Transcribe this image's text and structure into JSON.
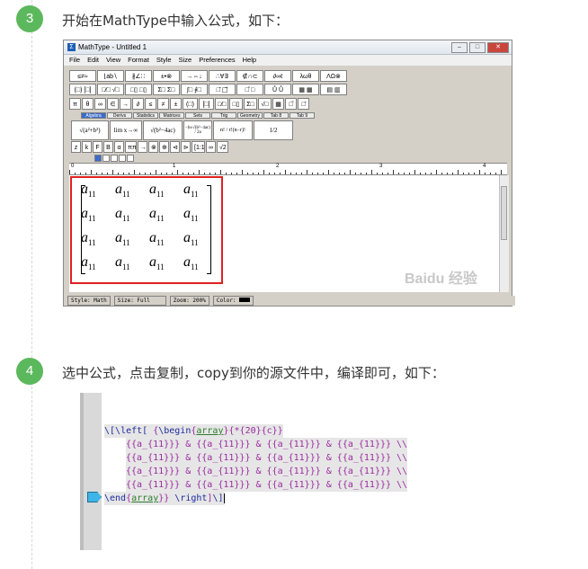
{
  "steps": [
    {
      "number": "3",
      "text": "开始在MathType中输入公式，如下："
    },
    {
      "number": "4",
      "text": "选中公式，点击复制，copy到你的源文件中，编译即可，如下："
    }
  ],
  "mathtype": {
    "title": "MathType - Untitled 1",
    "window_buttons": [
      "–",
      "□",
      "✕"
    ],
    "menu": [
      "File",
      "Edit",
      "View",
      "Format",
      "Style",
      "Size",
      "Preferences",
      "Help"
    ],
    "toolbar_row1": [
      "≤≠≈",
      "⌊ab∖",
      "∦∠∷",
      "±•⊗",
      "→⇔↓",
      "∴∀∃",
      "∉∩⊂",
      "∂∞ℓ",
      "λωθ",
      "ΛΩ⊗"
    ],
    "toolbar_row2": [
      "(□) [□]",
      "□⁄□ √□",
      "□▯ □▯",
      "Σ□ Σ□",
      "∫□ ∮□",
      "□̄ □⃗",
      "□̂ □",
      "Ů Ů",
      "▦ ▦",
      "▤ ▥"
    ],
    "toolbar_row3": [
      "π",
      "θ",
      "∞",
      "∈",
      "→",
      "∂",
      "≤",
      "≠",
      "±",
      "(□)",
      "[□]",
      "□⁄□",
      "□▯",
      "Σ□",
      "√□",
      "▦",
      "□̂",
      "□̄"
    ],
    "tabs": [
      "Algebra",
      "Derivs",
      "Statistics",
      "Matrices",
      "Sets",
      "Trig",
      "Geometry",
      "Tab 8",
      "Tab 9"
    ],
    "template_buttons": [
      "√(a²+b²)",
      "lim x→∞",
      "√(b²−4ac)",
      "−b±√(b²−4ac) / 2a",
      "n! / r!(n−r)!",
      "1/2"
    ],
    "toolbar_row5": [
      "z",
      "k",
      "F",
      "B",
      "α",
      "ππ",
      "→",
      "⊗",
      "⊕",
      "⊲",
      "⊳",
      "[1:1]",
      "∞",
      "√2"
    ],
    "ruler_numbers": [
      "0",
      "1",
      "2",
      "3",
      "4"
    ],
    "matrix": {
      "rows": [
        [
          "a",
          "a",
          "a",
          "a"
        ],
        [
          "a",
          "a",
          "a",
          "a"
        ],
        [
          "a",
          "a",
          "a",
          "a"
        ],
        [
          "a",
          "a",
          "a",
          "a"
        ]
      ],
      "subscript": "11"
    },
    "status": {
      "style": "Style: Math",
      "size": "Size: Full",
      "zoom": "Zoom: 200%",
      "color": "Color:"
    },
    "watermark": "Baidu 经验"
  },
  "code": {
    "line1": {
      "a": "\\[",
      "b": "\\left[",
      "c": " {",
      "d": "\\begin",
      "e": "{",
      "f": "array",
      "g": "}",
      "h": "{*{20}{c}}"
    },
    "row_text": "{{a_{11}}} & {{a_{11}}} & {{a_{11}}} & {{a_{11}}} \\\\",
    "last": {
      "a": "\\end",
      "b": "{",
      "c": "array",
      "d": "}} ",
      "e": "\\right",
      "f": "]",
      "g": "\\]"
    }
  },
  "colors": {
    "step_circle": "#5cb85c",
    "highlight_box": "#e02020",
    "code_command": "#1e2b9e",
    "code_env": "#2f7d2f",
    "code_arg": "#9b2aa0"
  }
}
